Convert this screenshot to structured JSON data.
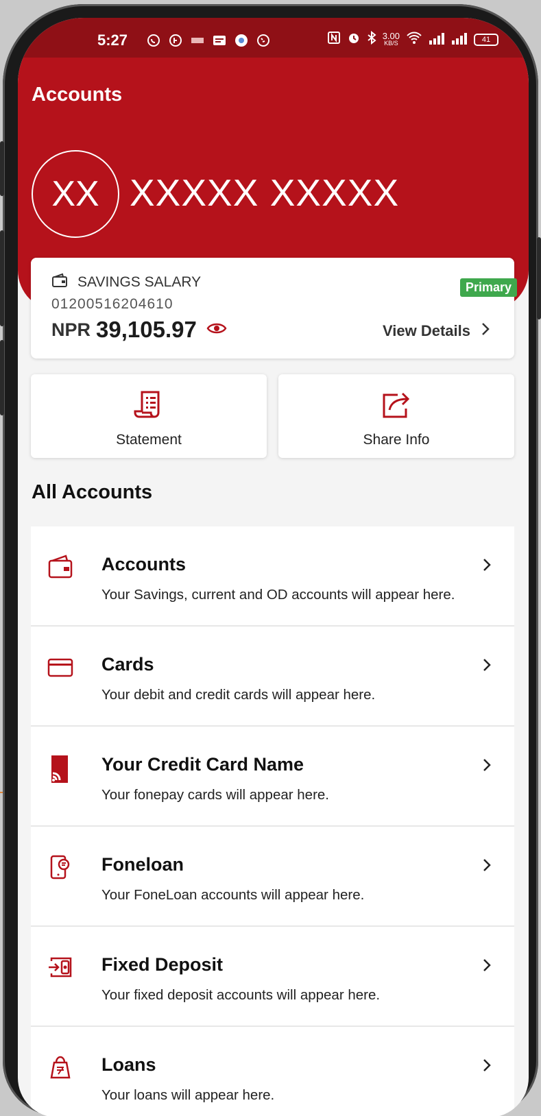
{
  "status_bar": {
    "time": "5:27",
    "battery": "41",
    "net_speed_value": "3.00",
    "net_speed_unit": "KB/S",
    "notification_icons": [
      "whatsapp-icon",
      "whatsapp-business-icon",
      "notification-icon",
      "message-icon",
      "chrome-icon",
      "viber-icon"
    ],
    "system_icons": [
      "nfc-icon",
      "alarm-icon",
      "bluetooth-icon",
      "wifi-icon",
      "signal-icon",
      "signal-icon"
    ]
  },
  "header": {
    "title": "Accounts",
    "avatar_initials": "XX",
    "user_name": "XXXXX  XXXXX"
  },
  "primary_account": {
    "type": "SAVINGS SALARY",
    "number": "01200516204610",
    "currency": "NPR",
    "balance": "39,105.97",
    "badge": "Primary",
    "view_details_label": "View Details"
  },
  "quick_actions": [
    {
      "label": "Statement",
      "icon": "statement-icon"
    },
    {
      "label": "Share Info",
      "icon": "share-icon"
    }
  ],
  "section_title": "All Accounts",
  "account_list": [
    {
      "title": "Accounts",
      "description": "Your Savings, current and OD accounts will appear here.",
      "icon": "wallet-icon"
    },
    {
      "title": "Cards",
      "description": "Your debit and credit cards will appear here.",
      "icon": "card-icon"
    },
    {
      "title": "Your Credit Card Name",
      "description": "Your fonepay cards will appear here.",
      "icon": "contactless-card-icon"
    },
    {
      "title": "Foneloan",
      "description": "Your FoneLoan accounts will appear here.",
      "icon": "phone-loan-icon"
    },
    {
      "title": "Fixed Deposit",
      "description": "Your fixed deposit accounts will appear here.",
      "icon": "fixed-deposit-icon"
    },
    {
      "title": "Loans",
      "description": "Your loans will appear here.",
      "icon": "loan-bag-icon"
    }
  ],
  "colors": {
    "brand_red": "#b5121b",
    "status_bar_red": "#8f1016",
    "primary_badge_green": "#3fa84d"
  }
}
